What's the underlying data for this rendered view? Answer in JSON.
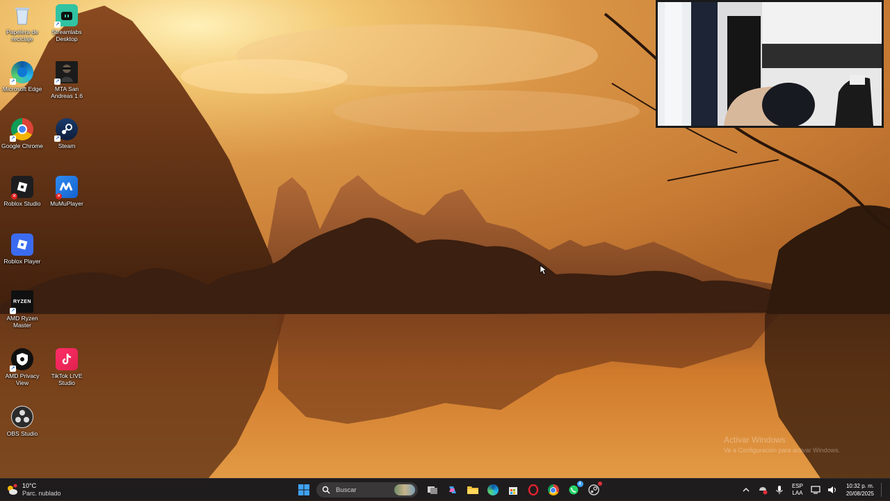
{
  "desktop": {
    "icons": [
      {
        "id": "recycle",
        "label": "Papelera de reciclaje",
        "icon": "recycle-bin-icon"
      },
      {
        "id": "streamlabs",
        "label": "Streamlabs Desktop",
        "icon": "streamlabs-icon"
      },
      {
        "id": "edge",
        "label": "Microsoft Edge",
        "icon": "edge-icon"
      },
      {
        "id": "mta",
        "label": "MTA San Andreas 1.6",
        "icon": "mta-icon"
      },
      {
        "id": "chrome",
        "label": "Google Chrome",
        "icon": "chrome-icon"
      },
      {
        "id": "steam",
        "label": "Steam",
        "icon": "steam-icon"
      },
      {
        "id": "roblox-studio",
        "label": "Roblox Studio",
        "icon": "roblox-studio-icon"
      },
      {
        "id": "mumu",
        "label": "MuMuPlayer",
        "icon": "mumu-icon"
      },
      {
        "id": "roblox-player",
        "label": "Roblox Player",
        "icon": "roblox-player-icon"
      },
      {
        "id": "ryzen",
        "label": "AMD Ryzen Master",
        "icon": "amd-ryzen-icon",
        "badge_text": "RYZEN"
      },
      {
        "id": "privacy",
        "label": "AMD Privacy View",
        "icon": "amd-privacy-icon"
      },
      {
        "id": "tiktok",
        "label": "TikTok LIVE Studio",
        "icon": "tiktok-icon"
      },
      {
        "id": "obs",
        "label": "OBS Studio",
        "icon": "obs-icon"
      }
    ]
  },
  "watermark": {
    "title": "Activar Windows",
    "subtitle": "Ve a Configuración para activar Windows."
  },
  "taskbar": {
    "weather": {
      "temp": "10°C",
      "condition": "Parc. nublado",
      "icon": "partly-cloudy-icon"
    },
    "search_placeholder": "Buscar",
    "pinned": [
      "start-icon",
      "task-view-icon",
      "copilot-icon",
      "file-explorer-icon",
      "edge-icon",
      "store-icon",
      "opera-icon",
      "chrome-icon",
      "whatsapp-icon",
      "steam-icon"
    ],
    "whatsapp_badge": "4",
    "tray": {
      "icons": [
        "chevron-up-icon",
        "security-icon",
        "microphone-icon"
      ],
      "lang_line1": "ESP",
      "lang_line2": "LAA",
      "time": "10:32 p. m.",
      "date": "20/08/2025"
    }
  },
  "colors": {
    "taskbar_bg": "#1f1c1e",
    "sky_top": "#d98e3c",
    "sky_glow": "#f6d98a",
    "water": "#c86a24"
  }
}
